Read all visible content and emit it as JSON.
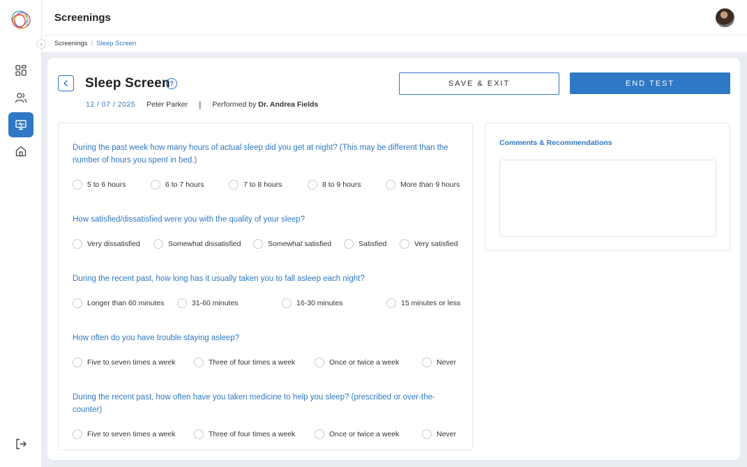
{
  "header": {
    "title": "Screenings"
  },
  "breadcrumb": {
    "parent": "Screenings",
    "separator": "/",
    "current": "Sleep Screen"
  },
  "page": {
    "title": "Sleep Screen",
    "date": "12 / 07 / 2025",
    "patient": "Peter Parker",
    "divider": "|",
    "performed_by_label": "Performed by",
    "performed_by_name": "Dr. Andrea Fields"
  },
  "actions": {
    "save_exit": "SAVE & EXIT",
    "end_test": "END TEST"
  },
  "questions": [
    {
      "text": "During the past week how many hours of actual sleep did you get at night? (This may be different than the number of hours you spent in bed.)",
      "options": [
        "5 to 6 hours",
        "6 to 7 hours",
        "7 to 8 hours",
        "8 to 9 hours",
        "More than 9 hours"
      ]
    },
    {
      "text": "How satisfied/dissatisfied were you with the quality of your sleep?",
      "options": [
        "Very dissatisfied",
        "Somewhat dissatisfied",
        "Somewhat satisfied",
        "Satisfied",
        "Very satisfied"
      ]
    },
    {
      "text": "During the recent past, how long has it usually taken you to fall asleep each night?",
      "options": [
        "Longer than 60 minutes",
        "31-60 minutes",
        "16-30 minutes",
        "15 minutes or less"
      ]
    },
    {
      "text": "How often do you have trouble staying asleep?",
      "options": [
        "Five to seven times a week",
        "Three of four times a week",
        "Once or twice a week",
        "Never"
      ]
    },
    {
      "text": "During the recent past, how often have you taken medicine to help you sleep? (prescribed or over-the-counter)",
      "options": [
        "Five to seven times a week",
        "Three of four times a week",
        "Once or twice a week",
        "Never"
      ]
    }
  ],
  "comments": {
    "title": "Comments & Recommendations",
    "value": ""
  },
  "sidebar": {
    "items": [
      {
        "name": "dashboard-icon"
      },
      {
        "name": "users-icon"
      },
      {
        "name": "screening-monitor-icon",
        "active": true
      },
      {
        "name": "home-icon"
      }
    ],
    "logout_icon": "logout-icon"
  },
  "colors": {
    "accent": "#2f78c5",
    "background": "#e9ecf0"
  }
}
